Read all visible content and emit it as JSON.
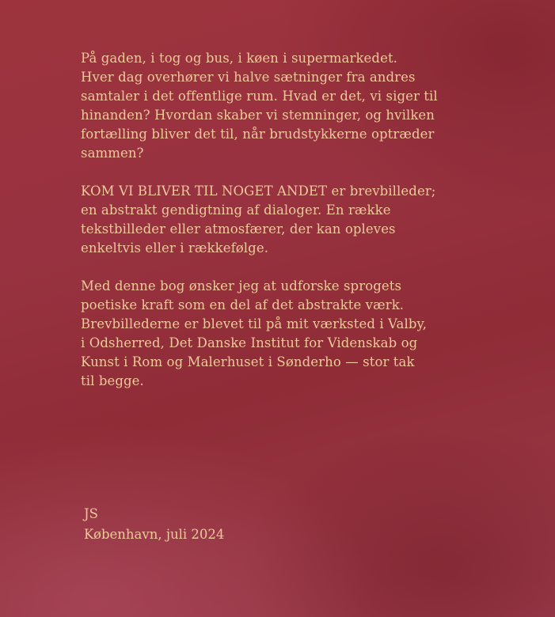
{
  "paragraphs": [
    {
      "lines": [
        "På gaden, i tog og bus, i køen i supermarkedet.",
        "Hver dag overhører vi halve sætninger fra andres",
        "samtaler i det offentlige rum. Hvad er det, vi siger til",
        "hinanden? Hvordan skaber vi stemninger, og hvilken",
        "fortælling bliver det til, når brudstykkerne optræder",
        "sammen?"
      ]
    },
    {
      "lines": [
        "KOM VI BLIVER TIL NOGET ANDET er brevbilleder;",
        "en abstrakt gendigtning af dialoger. En række",
        "tekstbilleder eller atmosfærer, der kan opleves",
        "enkeltvis eller i rækkefølge."
      ]
    },
    {
      "lines": [
        "Med denne bog ønsker jeg at udforske sprogets",
        "poetiske kraft som en del af det abstrakte værk.",
        "Brevbillederne er blevet til på mit værksted i Valby,",
        "i Odsherred, Det Danske Institut for Videnskab og",
        "Kunst i Rom og Malerhuset i Sønderho — stor tak",
        "til begge."
      ]
    }
  ],
  "signature": {
    "initials": "JS",
    "place_date": "København, juli 2024"
  },
  "colors": {
    "background": "#93303a",
    "text": "#f1c99a"
  }
}
